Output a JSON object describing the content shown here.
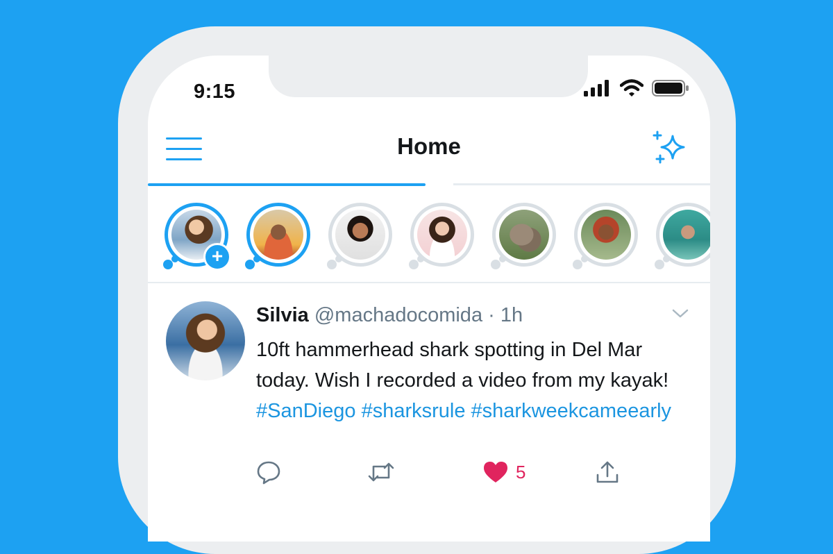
{
  "status_bar": {
    "time": "9:15",
    "icons": [
      "cellular-signal-icon",
      "wifi-icon",
      "battery-icon"
    ]
  },
  "header": {
    "title": "Home",
    "menu_icon": "hamburger-menu-icon",
    "timeline_icon": "sparkle-icon"
  },
  "tabs": {
    "active_index": 0,
    "count": 2
  },
  "fleets": [
    {
      "type": "own",
      "seen": false,
      "has_add_badge": true,
      "add_label": "+"
    },
    {
      "type": "user",
      "seen": false
    },
    {
      "type": "user",
      "seen": true
    },
    {
      "type": "user",
      "seen": true
    },
    {
      "type": "user",
      "seen": true
    },
    {
      "type": "user",
      "seen": true
    },
    {
      "type": "user",
      "seen": true
    }
  ],
  "tweet": {
    "display_name": "Silvia",
    "handle": "@machadocomida",
    "separator": "·",
    "timestamp": "1h",
    "text_plain_1": "10ft hammerhead shark spotting in Del Mar today. Wish I recorded a video from my kayak! ",
    "hashtags": [
      "#SanDiego",
      "#sharksrule",
      "#sharkweekcameearly"
    ],
    "like_count": "5",
    "liked": true,
    "actions": [
      "reply-icon",
      "retweet-icon",
      "like-icon",
      "share-icon"
    ]
  },
  "colors": {
    "background": "#1DA1F2",
    "accent": "#1DA1F2",
    "hashtag": "#1B95E0",
    "like": "#E0245E",
    "text_primary": "#14171A",
    "text_secondary": "#657786"
  }
}
